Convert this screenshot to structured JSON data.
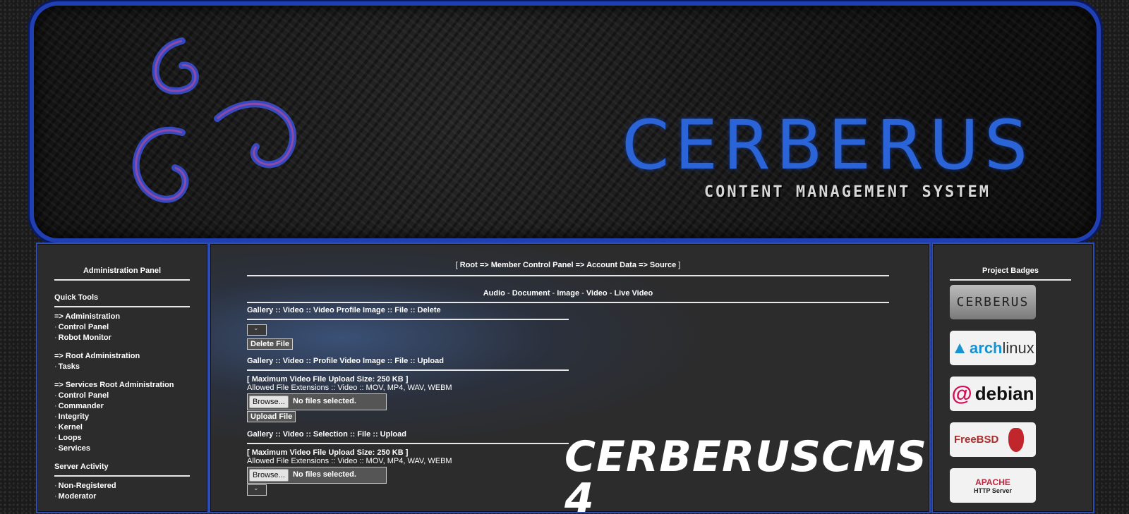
{
  "banner": {
    "title": "CERBERUS",
    "subtitle": "CONTENT MANAGEMENT SYSTEM"
  },
  "left_panel": {
    "title": "Administration Panel",
    "quick_tools": "Quick Tools",
    "admin_header": "=> Administration",
    "admin_items": [
      "Control Panel",
      "Robot Monitor"
    ],
    "root_header": "=> Root Administration",
    "root_items": [
      "Tasks"
    ],
    "services_header": "=> Services Root Administration",
    "services_items": [
      "Control Panel",
      "Commander",
      "Integrity",
      "Kernel",
      "Loops",
      "Services"
    ],
    "server_activity": "Server Activity",
    "activity_items": [
      "Non-Registered",
      "Moderator"
    ]
  },
  "breadcrumb": {
    "open": "[",
    "path": "Root => Member Control Panel => Account Data => Source",
    "close": "]"
  },
  "categories": [
    "Audio",
    "Document",
    "Image",
    "Video",
    "Live Video"
  ],
  "category_separator": "-",
  "delete_form": {
    "heading": "Gallery :: Video :: Video Profile Image :: File :: Delete",
    "button": "Delete File"
  },
  "upload_profile_form": {
    "heading": "Gallery :: Video :: Profile Video Image :: File :: Upload",
    "max_size": "[ Maximum Video File Upload Size: 250 KB ]",
    "extensions": "Allowed File Extensions :: Video :: MOV, MP4, WAV, WEBM",
    "browse": "Browse...",
    "no_file": "No files selected.",
    "button": "Upload File"
  },
  "upload_selection_form": {
    "heading": "Gallery :: Video :: Selection :: File :: Upload",
    "max_size": "[ Maximum Video File Upload Size: 250 KB ]",
    "extensions": "Allowed File Extensions :: Video :: MOV, MP4, WAV, WEBM",
    "browse": "Browse...",
    "no_file": "No files selected."
  },
  "watermark": "CERBERUSCMS 4",
  "right_panel": {
    "title": "Project Badges",
    "badges": [
      {
        "name": "CERBERUS"
      },
      {
        "name": "arch",
        "name2": "linux"
      },
      {
        "name": "debian"
      },
      {
        "name": "FreeBSD"
      },
      {
        "name": "APACHE",
        "name2": "HTTP Server"
      }
    ]
  }
}
